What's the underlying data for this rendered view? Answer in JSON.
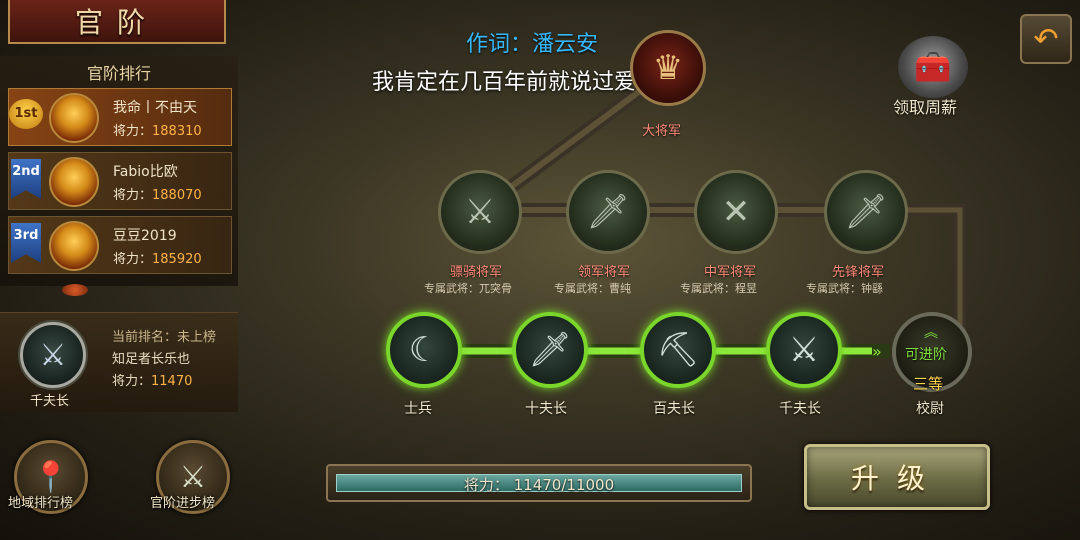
{
  "header": {
    "title": "官阶"
  },
  "ranking": {
    "title": "官阶排行",
    "power_prefix": "将力：",
    "entries": [
      {
        "badge": "1st",
        "name": "我命丨不由天",
        "power": "188310"
      },
      {
        "badge": "2nd",
        "name": "Fabio比欧",
        "power": "188070"
      },
      {
        "badge": "3rd",
        "name": "豆豆2019",
        "power": "185920"
      }
    ]
  },
  "current": {
    "rank_label": "当前排名：",
    "rank_value": "未上榜",
    "player_name": "知足者长乐也",
    "power_label": "将力：",
    "power_value": "11470",
    "emblem_title": "千夫长"
  },
  "bottom_buttons": {
    "regional": "地域排行榜",
    "progress": "官阶进步榜"
  },
  "overlay": {
    "lyric_author": "作词：潘云安",
    "lyric_line": "我肯定在几百年前就说过爱你"
  },
  "top_right": {
    "weekly_salary": "领取周薪"
  },
  "tree": {
    "supreme": {
      "title": "大将军"
    },
    "generals": [
      {
        "title": "骠骑将军",
        "sub": "专属武将：兀突骨"
      },
      {
        "title": "领军将军",
        "sub": "专属武将：曹纯"
      },
      {
        "title": "中军将军",
        "sub": "专属武将：程昱"
      },
      {
        "title": "先锋将军",
        "sub": "专属武将：钟繇"
      }
    ],
    "tiers": [
      {
        "label": "士兵"
      },
      {
        "label": "十夫长"
      },
      {
        "label": "百夫长"
      },
      {
        "label": "千夫长"
      }
    ],
    "next": {
      "status": "可进阶",
      "rank": "三等",
      "name": "校尉"
    }
  },
  "power_bar": {
    "text": "将力：  11470/11000",
    "current": 11470,
    "max": 11000
  },
  "upgrade": {
    "label": "升级"
  },
  "icons": {
    "back": "back-arrow-icon",
    "chest": "treasure-chest-icon",
    "map_pin": "map-pin-icon",
    "swords": "crossed-swords-icon"
  },
  "colors": {
    "progress_green": "#7ad62a",
    "lyric_blue": "#35b8ff",
    "title_red": "#ff8a7a"
  }
}
